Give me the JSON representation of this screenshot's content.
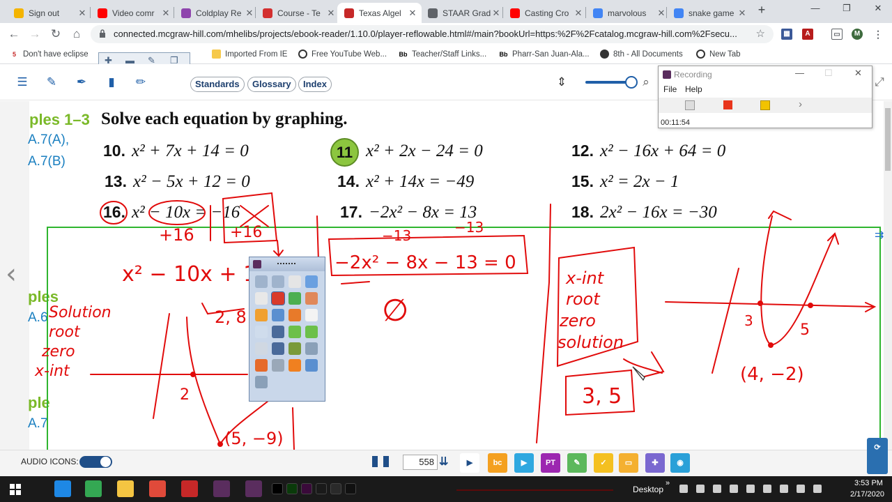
{
  "browser": {
    "tabs": [
      {
        "label": "Sign out",
        "icon": "google-classroom-icon",
        "color": "#f4b400"
      },
      {
        "label": "Video comr",
        "icon": "youtube-icon",
        "color": "#ff0000"
      },
      {
        "label": "Coldplay Re",
        "icon": "podcast-icon",
        "color": "#8e44ad"
      },
      {
        "label": "Course - Te",
        "icon": "mcgraw-icon",
        "color": "#d32f2f"
      },
      {
        "label": "Texas Algel",
        "icon": "mcgraw-book-icon",
        "color": "#c62828"
      },
      {
        "label": "STAAR Grad",
        "icon": "globe-icon",
        "color": "#5f6368"
      },
      {
        "label": "Casting Cro",
        "icon": "youtube-icon",
        "color": "#ff0000"
      },
      {
        "label": "marvolous",
        "icon": "google-icon",
        "color": "#4285f4"
      },
      {
        "label": "snake game",
        "icon": "google-icon",
        "color": "#4285f4"
      }
    ],
    "active_tab": 4,
    "url": "connected.mcgraw-hill.com/mhelibs/projects/ebook-reader/1.10.0/player-reflowable.html#/main?bookUrl=https:%2F%2Fcatalog.mcgraw-hill.com%2Fsecu...",
    "profile_initial": "M",
    "bookmarks": [
      {
        "label": "Don't have eclipse",
        "icon": "eclipse-icon"
      },
      {
        "label": "Imported From IE",
        "icon": "folder-icon"
      },
      {
        "label": "Free YouTube Web...",
        "icon": "globe-icon"
      },
      {
        "label": "Teacher/Staff Links...",
        "icon": "blackboard-icon"
      },
      {
        "label": "Pharr-San Juan-Ala...",
        "icon": "blackboard-icon"
      },
      {
        "label": "8th - All Documents",
        "icon": "docs-icon"
      },
      {
        "label": "New Tab",
        "icon": "globe-icon"
      }
    ]
  },
  "reader": {
    "buttons": [
      "Standards",
      "Glossary",
      "Index"
    ]
  },
  "page": {
    "examples_heading": "ples 1–3",
    "teks": [
      "A.7(A),",
      "A.7(B)"
    ],
    "title": "Solve each equation by graphing.",
    "problems": [
      {
        "num": "10.",
        "eq": "x² + 7x + 14 = 0"
      },
      {
        "num": "11",
        "eq": "x² + 2x − 24 = 0"
      },
      {
        "num": "12.",
        "eq": "x² − 16x + 64 = 0"
      },
      {
        "num": "13.",
        "eq": "x² − 5x + 12 = 0"
      },
      {
        "num": "14.",
        "eq": "x² + 14x = −49"
      },
      {
        "num": "15.",
        "eq": "x² = 2x − 1"
      },
      {
        "num": "16.",
        "eq": "x² − 10x = −16"
      },
      {
        "num": "17.",
        "eq": "−2x² − 8x = 13"
      },
      {
        "num": "18.",
        "eq": "2x² − 16x = −30"
      }
    ],
    "side_fragments": [
      "ples",
      "A.6",
      "ple",
      "A.7"
    ]
  },
  "ink_text": {
    "left_notes": [
      "Solution",
      "root",
      "zero",
      "x-int"
    ],
    "eq16": "x² − 10x + 16",
    "plus16a": "+16",
    "plus16b": "+16",
    "vertex16": "(5, −9)",
    "two": "2",
    "eq17_minus": "−13",
    "eq17_minus2": "−13",
    "eq17": "−2x² − 8x − 13 = 0",
    "empty": "∅",
    "box_notes": [
      "x-int",
      "root",
      "zero",
      "solution"
    ],
    "answer": "3, 5",
    "x3": "3",
    "x5": "5",
    "vertex18": "(4, −2)"
  },
  "recording": {
    "title": "Recording",
    "menu": [
      "File",
      "Help"
    ],
    "timer": "00:11:54"
  },
  "bottom": {
    "audio_label": "AUDIO ICONS:",
    "page_number": "558"
  },
  "taskbar": {
    "desktop_label": "Desktop",
    "time": "3:53 PM",
    "date": "2/17/2020"
  }
}
